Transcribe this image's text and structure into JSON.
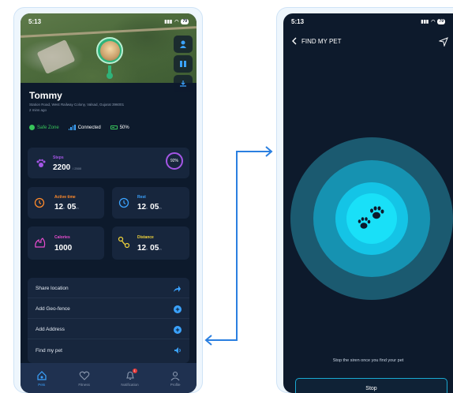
{
  "colors": {
    "background": "#0d1a2c",
    "card": "#17263d",
    "accent_blue": "#3ba3ff",
    "safe_green": "#37c45a",
    "steps_purple": "#a556e6",
    "active_orange": "#ff8a2b",
    "rest_blue": "#3ba3ff",
    "calories_pink": "#e84ccf",
    "distance_yellow": "#f2d43b",
    "ring_outer": "#1b5a70",
    "ring_inner": "#19e0f8"
  },
  "left_phone": {
    "status": {
      "time": "5:13",
      "battery": "79"
    },
    "pet": {
      "name": "Tommy",
      "address": "Station Road, West Railway Colony, Valsad, Gujarat 396001",
      "updated": "2 mins ago"
    },
    "badges": {
      "safe_zone": "Safe Zone",
      "connected": "Connected",
      "battery": "50%"
    },
    "steps": {
      "label": "Steps",
      "value": "2200",
      "goal": "/ 2500",
      "percent": "92%"
    },
    "active_time": {
      "label": "Active time",
      "hours": "12",
      "h_unit": "h",
      "minutes": "05",
      "m_unit": "m"
    },
    "rest": {
      "label": "Rest",
      "hours": "12",
      "h_unit": "h",
      "minutes": "05",
      "m_unit": "m"
    },
    "calories": {
      "label": "Calories",
      "value": "1000"
    },
    "distance": {
      "label": "Distance",
      "hours": "12",
      "h_unit": "h",
      "minutes": "05",
      "m_unit": "m"
    },
    "actions": [
      {
        "label": "Share location",
        "icon": "share-arrow-icon"
      },
      {
        "label": "Add Geo-fence",
        "icon": "plus-icon"
      },
      {
        "label": "Add Address",
        "icon": "plus-icon"
      },
      {
        "label": "Find my pet",
        "icon": "speaker-icon"
      }
    ],
    "nav": [
      {
        "label": "Pets",
        "icon": "paw-house-icon",
        "active": true
      },
      {
        "label": "Fitness",
        "icon": "heart-icon",
        "active": false
      },
      {
        "label": "Notification",
        "icon": "bell-icon",
        "active": false,
        "badge": "1"
      },
      {
        "label": "Profile",
        "icon": "person-icon",
        "active": false
      }
    ]
  },
  "right_phone": {
    "status": {
      "time": "5:13",
      "battery": "79"
    },
    "title": "FIND MY PET",
    "instruction": "Stop the siren once you find your pet",
    "stop_label": "Stop"
  }
}
